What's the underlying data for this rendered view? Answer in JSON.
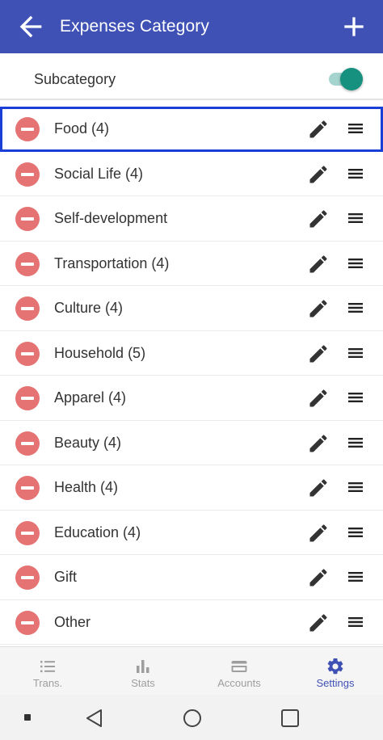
{
  "appbar": {
    "title": "Expenses Category"
  },
  "subcategory": {
    "label": "Subcategory",
    "enabled": true
  },
  "categories": [
    {
      "name": "Food (4)"
    },
    {
      "name": "Social Life (4)"
    },
    {
      "name": "Self-development"
    },
    {
      "name": "Transportation (4)"
    },
    {
      "name": "Culture (4)"
    },
    {
      "name": "Household (5)"
    },
    {
      "name": "Apparel (4)"
    },
    {
      "name": "Beauty (4)"
    },
    {
      "name": "Health (4)"
    },
    {
      "name": "Education (4)"
    },
    {
      "name": "Gift"
    },
    {
      "name": "Other"
    }
  ],
  "bottom_nav": [
    {
      "label": "Trans.",
      "icon": "list-icon"
    },
    {
      "label": "Stats",
      "icon": "bar-chart-icon"
    },
    {
      "label": "Accounts",
      "icon": "card-icon"
    },
    {
      "label": "Settings",
      "icon": "gear-icon",
      "active": true
    }
  ],
  "colors": {
    "appbar": "#3f51b5",
    "delete": "#e57373",
    "toggle": "#16917f",
    "selection": "#1a3fd6",
    "active_nav": "#3f51b5"
  }
}
